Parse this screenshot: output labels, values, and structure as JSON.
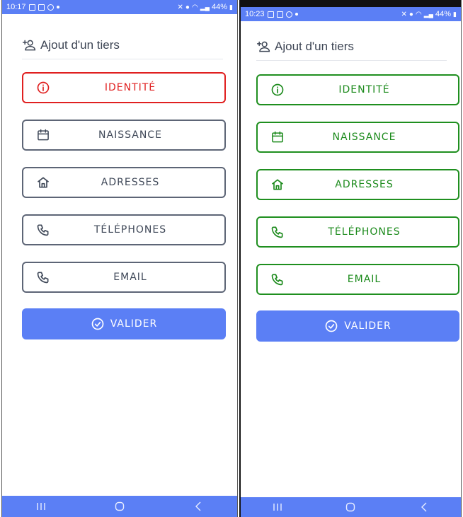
{
  "screens": [
    {
      "status": {
        "time": "10:17",
        "battery": "44%"
      },
      "header": {
        "title": "Ajout d'un tiers"
      },
      "buttons": [
        {
          "label": "IDENTITÉ",
          "icon": "info-icon",
          "state": "error",
          "color": "#e02020"
        },
        {
          "label": "NAISSANCE",
          "icon": "calendar-icon",
          "state": "default",
          "color": "#3f4858"
        },
        {
          "label": "ADRESSES",
          "icon": "home-icon",
          "state": "default",
          "color": "#3f4858"
        },
        {
          "label": "TÉLÉPHONES",
          "icon": "phone-icon",
          "state": "default",
          "color": "#3f4858"
        },
        {
          "label": "EMAIL",
          "icon": "phone-icon",
          "state": "default",
          "color": "#3f4858"
        }
      ],
      "validate": {
        "label": "VALIDER",
        "icon": "check-circle-icon"
      }
    },
    {
      "status": {
        "time": "10:23",
        "battery": "44%"
      },
      "header": {
        "title": "Ajout d'un tiers"
      },
      "buttons": [
        {
          "label": "IDENTITÉ",
          "icon": "info-icon",
          "state": "valid",
          "color": "#1b8a1b"
        },
        {
          "label": "NAISSANCE",
          "icon": "calendar-icon",
          "state": "valid",
          "color": "#1b8a1b"
        },
        {
          "label": "ADRESSES",
          "icon": "home-icon",
          "state": "valid",
          "color": "#1b8a1b"
        },
        {
          "label": "TÉLÉPHONES",
          "icon": "phone-icon",
          "state": "valid",
          "color": "#1b8a1b"
        },
        {
          "label": "EMAIL",
          "icon": "phone-icon",
          "state": "valid",
          "color": "#1b8a1b"
        }
      ],
      "validate": {
        "label": "VALIDER",
        "icon": "check-circle-icon"
      }
    }
  ],
  "colors": {
    "accent": "#5b7ff5",
    "error": "#e02020",
    "success": "#1b8a1b",
    "neutral": "#5d6576"
  }
}
